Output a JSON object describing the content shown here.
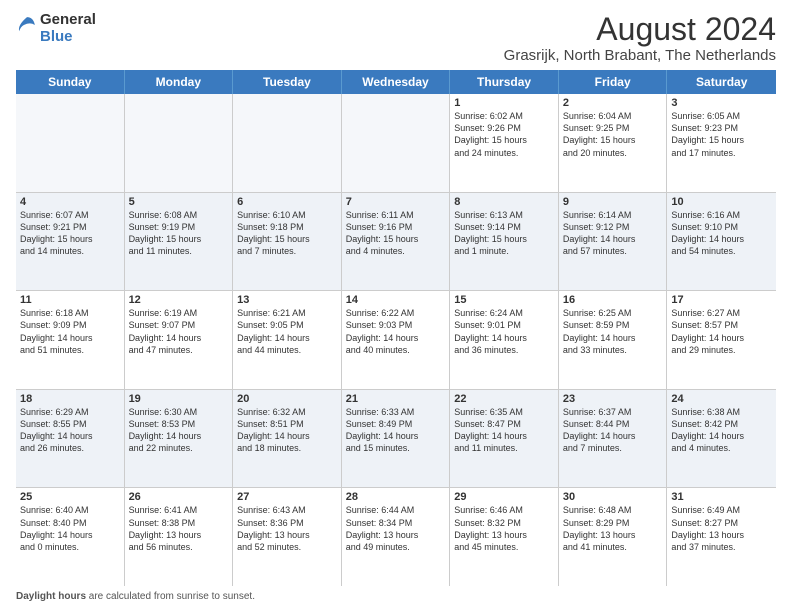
{
  "logo": {
    "line1": "General",
    "line2": "Blue"
  },
  "title": "August 2024",
  "subtitle": "Grasrijk, North Brabant, The Netherlands",
  "days_of_week": [
    "Sunday",
    "Monday",
    "Tuesday",
    "Wednesday",
    "Thursday",
    "Friday",
    "Saturday"
  ],
  "footer_label": "Daylight hours",
  "footer_text": " are calculated from sunrise to sunset.",
  "rows": [
    [
      {
        "day": "",
        "text": ""
      },
      {
        "day": "",
        "text": ""
      },
      {
        "day": "",
        "text": ""
      },
      {
        "day": "",
        "text": ""
      },
      {
        "day": "1",
        "text": "Sunrise: 6:02 AM\nSunset: 9:26 PM\nDaylight: 15 hours\nand 24 minutes."
      },
      {
        "day": "2",
        "text": "Sunrise: 6:04 AM\nSunset: 9:25 PM\nDaylight: 15 hours\nand 20 minutes."
      },
      {
        "day": "3",
        "text": "Sunrise: 6:05 AM\nSunset: 9:23 PM\nDaylight: 15 hours\nand 17 minutes."
      }
    ],
    [
      {
        "day": "4",
        "text": "Sunrise: 6:07 AM\nSunset: 9:21 PM\nDaylight: 15 hours\nand 14 minutes."
      },
      {
        "day": "5",
        "text": "Sunrise: 6:08 AM\nSunset: 9:19 PM\nDaylight: 15 hours\nand 11 minutes."
      },
      {
        "day": "6",
        "text": "Sunrise: 6:10 AM\nSunset: 9:18 PM\nDaylight: 15 hours\nand 7 minutes."
      },
      {
        "day": "7",
        "text": "Sunrise: 6:11 AM\nSunset: 9:16 PM\nDaylight: 15 hours\nand 4 minutes."
      },
      {
        "day": "8",
        "text": "Sunrise: 6:13 AM\nSunset: 9:14 PM\nDaylight: 15 hours\nand 1 minute."
      },
      {
        "day": "9",
        "text": "Sunrise: 6:14 AM\nSunset: 9:12 PM\nDaylight: 14 hours\nand 57 minutes."
      },
      {
        "day": "10",
        "text": "Sunrise: 6:16 AM\nSunset: 9:10 PM\nDaylight: 14 hours\nand 54 minutes."
      }
    ],
    [
      {
        "day": "11",
        "text": "Sunrise: 6:18 AM\nSunset: 9:09 PM\nDaylight: 14 hours\nand 51 minutes."
      },
      {
        "day": "12",
        "text": "Sunrise: 6:19 AM\nSunset: 9:07 PM\nDaylight: 14 hours\nand 47 minutes."
      },
      {
        "day": "13",
        "text": "Sunrise: 6:21 AM\nSunset: 9:05 PM\nDaylight: 14 hours\nand 44 minutes."
      },
      {
        "day": "14",
        "text": "Sunrise: 6:22 AM\nSunset: 9:03 PM\nDaylight: 14 hours\nand 40 minutes."
      },
      {
        "day": "15",
        "text": "Sunrise: 6:24 AM\nSunset: 9:01 PM\nDaylight: 14 hours\nand 36 minutes."
      },
      {
        "day": "16",
        "text": "Sunrise: 6:25 AM\nSunset: 8:59 PM\nDaylight: 14 hours\nand 33 minutes."
      },
      {
        "day": "17",
        "text": "Sunrise: 6:27 AM\nSunset: 8:57 PM\nDaylight: 14 hours\nand 29 minutes."
      }
    ],
    [
      {
        "day": "18",
        "text": "Sunrise: 6:29 AM\nSunset: 8:55 PM\nDaylight: 14 hours\nand 26 minutes."
      },
      {
        "day": "19",
        "text": "Sunrise: 6:30 AM\nSunset: 8:53 PM\nDaylight: 14 hours\nand 22 minutes."
      },
      {
        "day": "20",
        "text": "Sunrise: 6:32 AM\nSunset: 8:51 PM\nDaylight: 14 hours\nand 18 minutes."
      },
      {
        "day": "21",
        "text": "Sunrise: 6:33 AM\nSunset: 8:49 PM\nDaylight: 14 hours\nand 15 minutes."
      },
      {
        "day": "22",
        "text": "Sunrise: 6:35 AM\nSunset: 8:47 PM\nDaylight: 14 hours\nand 11 minutes."
      },
      {
        "day": "23",
        "text": "Sunrise: 6:37 AM\nSunset: 8:44 PM\nDaylight: 14 hours\nand 7 minutes."
      },
      {
        "day": "24",
        "text": "Sunrise: 6:38 AM\nSunset: 8:42 PM\nDaylight: 14 hours\nand 4 minutes."
      }
    ],
    [
      {
        "day": "25",
        "text": "Sunrise: 6:40 AM\nSunset: 8:40 PM\nDaylight: 14 hours\nand 0 minutes."
      },
      {
        "day": "26",
        "text": "Sunrise: 6:41 AM\nSunset: 8:38 PM\nDaylight: 13 hours\nand 56 minutes."
      },
      {
        "day": "27",
        "text": "Sunrise: 6:43 AM\nSunset: 8:36 PM\nDaylight: 13 hours\nand 52 minutes."
      },
      {
        "day": "28",
        "text": "Sunrise: 6:44 AM\nSunset: 8:34 PM\nDaylight: 13 hours\nand 49 minutes."
      },
      {
        "day": "29",
        "text": "Sunrise: 6:46 AM\nSunset: 8:32 PM\nDaylight: 13 hours\nand 45 minutes."
      },
      {
        "day": "30",
        "text": "Sunrise: 6:48 AM\nSunset: 8:29 PM\nDaylight: 13 hours\nand 41 minutes."
      },
      {
        "day": "31",
        "text": "Sunrise: 6:49 AM\nSunset: 8:27 PM\nDaylight: 13 hours\nand 37 minutes."
      }
    ]
  ]
}
